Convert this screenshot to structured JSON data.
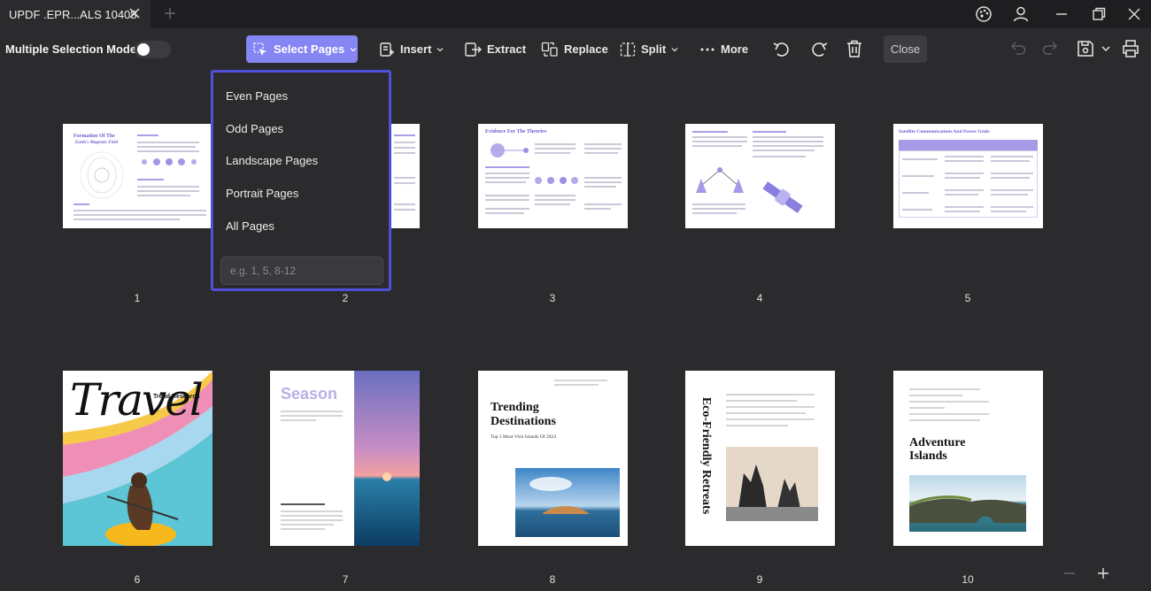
{
  "window": {
    "tab_title": "UPDF .EPR...ALS 10408"
  },
  "toolbar": {
    "multiple_selection_label": "Multiple Selection Mode",
    "multiple_selection_on": false,
    "select_pages": "Select Pages",
    "insert": "Insert",
    "extract": "Extract",
    "replace": "Replace",
    "split": "Split",
    "more": "More",
    "close": "Close"
  },
  "select_dropdown": {
    "items": [
      "Even Pages",
      "Odd Pages",
      "Landscape Pages",
      "Portrait Pages",
      "All Pages"
    ],
    "range_placeholder": "e.g. 1, 5, 8-12"
  },
  "pages": [
    {
      "number": "1",
      "title": "Formation Of The",
      "subtitle": "Earth's Magnetic Field"
    },
    {
      "number": "2"
    },
    {
      "number": "3",
      "title": "Evidence For The Theories"
    },
    {
      "number": "4"
    },
    {
      "number": "5",
      "title": "Satellite Communications And Power Grids"
    },
    {
      "number": "6",
      "title": "Travel",
      "subtitle": "Trend Research"
    },
    {
      "number": "7",
      "title": "Season"
    },
    {
      "number": "8",
      "title": "Trending Destinations",
      "subtitle": "Top 5 Must-Visit Islands Of 2024"
    },
    {
      "number": "9",
      "title": "Eco-Friendly Retreats"
    },
    {
      "number": "10",
      "title": "Adventure Islands"
    }
  ],
  "colors": {
    "accent": "#8585f4",
    "dropdown_border": "#4f4fd8",
    "background": "#2b2b2e",
    "titlebar": "#1e1e20"
  }
}
